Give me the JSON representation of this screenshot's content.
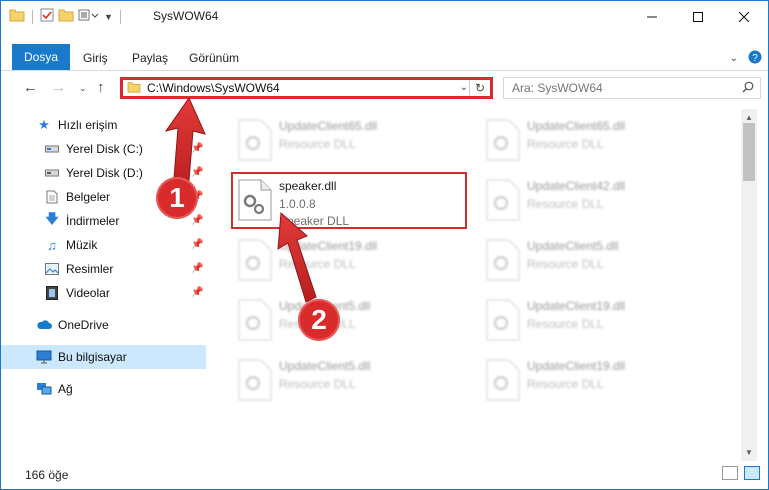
{
  "window": {
    "title": "SysWOW64"
  },
  "ribbon": {
    "tabs": [
      "Dosya",
      "Giriş",
      "Paylaş",
      "Görünüm"
    ]
  },
  "address": {
    "path": "C:\\Windows\\SysWOW64"
  },
  "search": {
    "placeholder": "Ara: SysWOW64"
  },
  "sidebar": {
    "items": [
      {
        "label": "Hızlı erişim",
        "icon": "star-icon"
      },
      {
        "label": "Yerel Disk (C:)",
        "icon": "drive-icon"
      },
      {
        "label": "Yerel Disk (D:)",
        "icon": "drive-icon"
      },
      {
        "label": "Belgeler",
        "icon": "documents-icon"
      },
      {
        "label": "İndirmeler",
        "icon": "download-icon"
      },
      {
        "label": "Müzik",
        "icon": "music-icon"
      },
      {
        "label": "Resimler",
        "icon": "pictures-icon"
      },
      {
        "label": "Videolar",
        "icon": "videos-icon"
      },
      {
        "label": "OneDrive",
        "icon": "cloud-icon"
      },
      {
        "label": "Bu bilgisayar",
        "icon": "computer-icon"
      },
      {
        "label": "Ağ",
        "icon": "network-icon"
      }
    ]
  },
  "files": [
    {
      "name": "UpdateClient65.dll",
      "line2": "Resource DLL",
      "line3": ""
    },
    {
      "name": "UpdateClient65.dll",
      "line2": "Resource DLL",
      "line3": ""
    },
    {
      "name": "speaker.dll",
      "line2": "1.0.0.8",
      "line3": "Speaker DLL"
    },
    {
      "name": "UpdateClient42.dll",
      "line2": "Resource DLL",
      "line3": ""
    },
    {
      "name": "UpdateClient19.dll",
      "line2": "Resource DLL",
      "line3": ""
    },
    {
      "name": "UpdateClient5.dll",
      "line2": "Resource DLL",
      "line3": ""
    },
    {
      "name": "UpdateClient5.dll",
      "line2": "Resource DLL",
      "line3": ""
    },
    {
      "name": "UpdateClient19.dll",
      "line2": "Resource DLL",
      "line3": ""
    },
    {
      "name": "UpdateClient5.dll",
      "line2": "Resource DLL",
      "line3": ""
    },
    {
      "name": "UpdateClient19.dll",
      "line2": "Resource DLL",
      "line3": ""
    }
  ],
  "status": {
    "count": "166 öğe"
  },
  "annotations": {
    "step1": "1",
    "step2": "2"
  },
  "colors": {
    "accent": "#1979ca",
    "highlight": "#d92b2b",
    "selection": "#cce8ff"
  }
}
